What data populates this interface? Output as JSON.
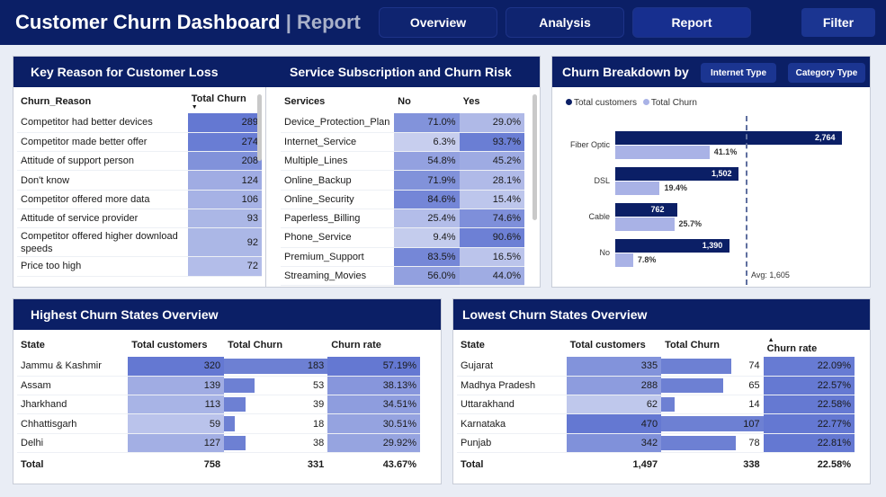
{
  "header": {
    "title": "Customer Churn Dashboard",
    "subtitle": "| Report",
    "nav": [
      "Overview",
      "Analysis",
      "Report"
    ],
    "active": "Report",
    "filter_label": "Filter"
  },
  "reasons": {
    "title": "Key Reason for Customer Loss",
    "columns": [
      "Churn_Reason",
      "Total Churn"
    ],
    "rows": [
      {
        "reason": "Competitor had better devices",
        "churn": "289",
        "level": 1.0
      },
      {
        "reason": "Competitor made better offer",
        "churn": "274",
        "level": 0.95
      },
      {
        "reason": "Attitude of support person",
        "churn": "208",
        "level": 0.72
      },
      {
        "reason": "Don't know",
        "churn": "124",
        "level": 0.43
      },
      {
        "reason": "Competitor offered more data",
        "churn": "106",
        "level": 0.37
      },
      {
        "reason": "Attitude of service provider",
        "churn": "93",
        "level": 0.32
      },
      {
        "reason": "Competitor offered higher download speeds",
        "churn": "92",
        "level": 0.32
      },
      {
        "reason": "Price too high",
        "churn": "72",
        "level": 0.25
      }
    ]
  },
  "services": {
    "title": "Service Subscription and Churn Risk",
    "columns": [
      "Services",
      "No",
      "Yes"
    ],
    "rows": [
      {
        "name": "Device_Protection_Plan",
        "no": "71.0%",
        "yes": "29.0%",
        "no_level": 0.71,
        "yes_level": 0.29
      },
      {
        "name": "Internet_Service",
        "no": "6.3%",
        "yes": "93.7%",
        "no_level": 0.06,
        "yes_level": 0.94
      },
      {
        "name": "Multiple_Lines",
        "no": "54.8%",
        "yes": "45.2%",
        "no_level": 0.55,
        "yes_level": 0.45
      },
      {
        "name": "Online_Backup",
        "no": "71.9%",
        "yes": "28.1%",
        "no_level": 0.72,
        "yes_level": 0.28
      },
      {
        "name": "Online_Security",
        "no": "84.6%",
        "yes": "15.4%",
        "no_level": 0.85,
        "yes_level": 0.15
      },
      {
        "name": "Paperless_Billing",
        "no": "25.4%",
        "yes": "74.6%",
        "no_level": 0.25,
        "yes_level": 0.75
      },
      {
        "name": "Phone_Service",
        "no": "9.4%",
        "yes": "90.6%",
        "no_level": 0.09,
        "yes_level": 0.91
      },
      {
        "name": "Premium_Support",
        "no": "83.5%",
        "yes": "16.5%",
        "no_level": 0.84,
        "yes_level": 0.17
      },
      {
        "name": "Streaming_Movies",
        "no": "56.0%",
        "yes": "44.0%",
        "no_level": 0.56,
        "yes_level": 0.44
      }
    ]
  },
  "breakdown": {
    "title": "Churn Breakdown by",
    "chips": [
      "Internet Type",
      "Category Type"
    ],
    "legend": [
      "Total customers",
      "Total Churn"
    ],
    "colors": {
      "customers": "#0b1f66",
      "churn": "#a9b2e6"
    },
    "avg_label": "Avg: 1,605"
  },
  "chart_data": {
    "type": "bar",
    "orientation": "horizontal",
    "categories": [
      "Fiber Optic",
      "DSL",
      "Cable",
      "No"
    ],
    "series": [
      {
        "name": "Total customers",
        "values": [
          2764,
          1502,
          762,
          1390
        ],
        "labels": [
          "2,764",
          "1,502",
          "762",
          "1,390"
        ]
      },
      {
        "name": "Total Churn",
        "values": [
          41.1,
          19.4,
          25.7,
          7.8
        ],
        "labels": [
          "41.1%",
          "19.4%",
          "25.7%",
          "7.8%"
        ]
      }
    ],
    "reference_line": {
      "label": "Avg: 1,605",
      "value": 1605
    },
    "legend": "top-left",
    "grid": false
  },
  "highest": {
    "title": "Highest Churn States Overview",
    "columns": [
      "State",
      "Total customers",
      "Total Churn",
      "Churn rate"
    ],
    "rows": [
      {
        "state": "Jammu & Kashmir",
        "customers": "320",
        "churn": "183",
        "rate": "57.19%",
        "cust_level": 1.0,
        "churn_level": 1.0,
        "rate_level": 1.0
      },
      {
        "state": "Assam",
        "customers": "139",
        "churn": "53",
        "rate": "38.13%",
        "cust_level": 0.43,
        "churn_level": 0.29,
        "rate_level": 0.67
      },
      {
        "state": "Jharkhand",
        "customers": "113",
        "churn": "39",
        "rate": "34.51%",
        "cust_level": 0.35,
        "churn_level": 0.21,
        "rate_level": 0.6
      },
      {
        "state": "Chhattisgarh",
        "customers": "59",
        "churn": "18",
        "rate": "30.51%",
        "cust_level": 0.18,
        "churn_level": 0.1,
        "rate_level": 0.53
      },
      {
        "state": "Delhi",
        "customers": "127",
        "churn": "38",
        "rate": "29.92%",
        "cust_level": 0.4,
        "churn_level": 0.21,
        "rate_level": 0.52
      }
    ],
    "total": {
      "label": "Total",
      "customers": "758",
      "churn": "331",
      "rate": "43.67%"
    }
  },
  "lowest": {
    "title": "Lowest Churn States Overview",
    "columns": [
      "State",
      "Total customers",
      "Total Churn",
      "Churn rate"
    ],
    "rows": [
      {
        "state": "Gujarat",
        "customers": "335",
        "churn": "74",
        "rate": "22.09%",
        "cust_level": 0.71,
        "churn_level": 0.69,
        "rate_level": 0.97
      },
      {
        "state": "Madhya Pradesh",
        "customers": "288",
        "churn": "65",
        "rate": "22.57%",
        "cust_level": 0.61,
        "churn_level": 0.61,
        "rate_level": 0.99
      },
      {
        "state": "Uttarakhand",
        "customers": "62",
        "churn": "14",
        "rate": "22.58%",
        "cust_level": 0.13,
        "churn_level": 0.13,
        "rate_level": 0.99
      },
      {
        "state": "Karnataka",
        "customers": "470",
        "churn": "107",
        "rate": "22.77%",
        "cust_level": 1.0,
        "churn_level": 1.0,
        "rate_level": 1.0
      },
      {
        "state": "Punjab",
        "customers": "342",
        "churn": "78",
        "rate": "22.81%",
        "cust_level": 0.73,
        "churn_level": 0.73,
        "rate_level": 1.0
      }
    ],
    "total": {
      "label": "Total",
      "customers": "1,497",
      "churn": "338",
      "rate": "22.58%"
    }
  }
}
